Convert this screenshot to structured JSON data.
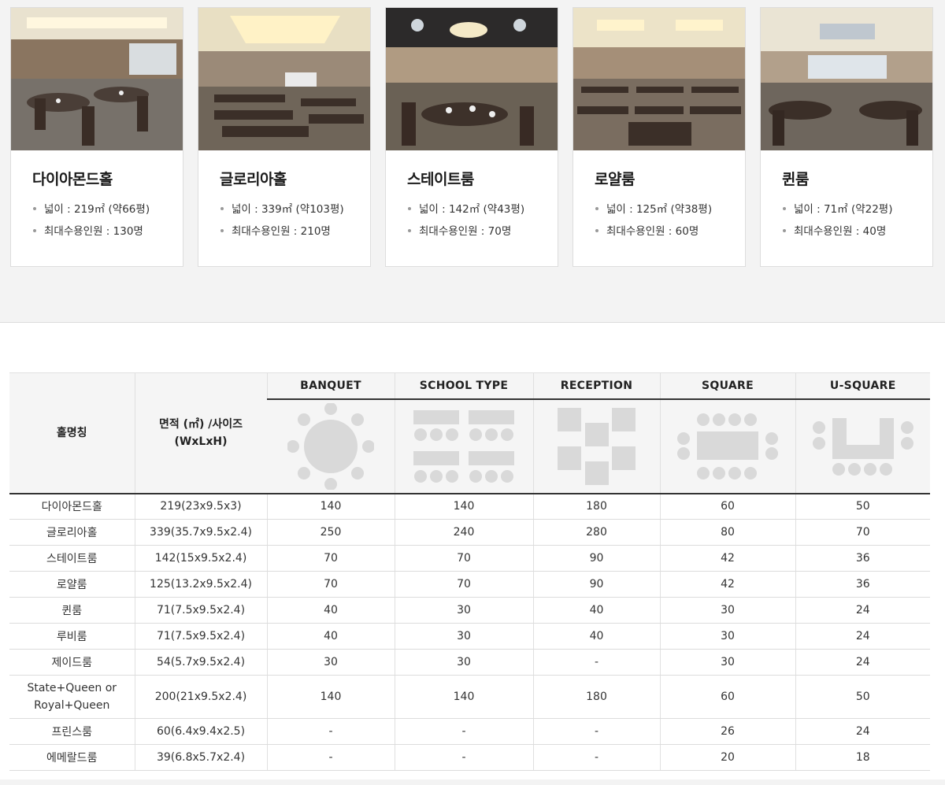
{
  "halls": [
    {
      "name": "다이아몬드홀",
      "area": "넓이 : 219㎡ (약66평)",
      "capacity": "최대수용인원 : 130명"
    },
    {
      "name": "글로리아홀",
      "area": "넓이 : 339㎡ (약103평)",
      "capacity": "최대수용인원 : 210명"
    },
    {
      "name": "스테이트룸",
      "area": "넓이 : 142㎡ (약43평)",
      "capacity": "최대수용인원 : 70명"
    },
    {
      "name": "로얄룸",
      "area": "넓이 : 125㎡ (약38평)",
      "capacity": "최대수용인원 : 60명"
    },
    {
      "name": "퀸룸",
      "area": "넓이 : 71㎡ (약22평)",
      "capacity": "최대수용인원 : 40명"
    }
  ],
  "table": {
    "hall_header": "홀명칭",
    "size_header_line1": "면적 (㎡) /사이즈",
    "size_header_line2": "(WxLxH)",
    "layouts": [
      "BANQUET",
      "SCHOOL TYPE",
      "RECEPTION",
      "SQUARE",
      "U-SQUARE"
    ],
    "rows": [
      [
        "다이아몬드홀",
        "219(23x9.5x3)",
        "140",
        "140",
        "180",
        "60",
        "50"
      ],
      [
        "글로리아홀",
        "339(35.7x9.5x2.4)",
        "250",
        "240",
        "280",
        "80",
        "70"
      ],
      [
        "스테이트룸",
        "142(15x9.5x2.4)",
        "70",
        "70",
        "90",
        "42",
        "36"
      ],
      [
        "로얄룸",
        "125(13.2x9.5x2.4)",
        "70",
        "70",
        "90",
        "42",
        "36"
      ],
      [
        "퀸룸",
        "71(7.5x9.5x2.4)",
        "40",
        "30",
        "40",
        "30",
        "24"
      ],
      [
        "루비룸",
        "71(7.5x9.5x2.4)",
        "40",
        "30",
        "40",
        "30",
        "24"
      ],
      [
        "제이드룸",
        "54(5.7x9.5x2.4)",
        "30",
        "30",
        "-",
        "30",
        "24"
      ],
      [
        "State+Queen or Royal+Queen",
        "200(21x9.5x2.4)",
        "140",
        "140",
        "180",
        "60",
        "50"
      ],
      [
        "프린스룸",
        "60(6.4x9.4x2.5)",
        "-",
        "-",
        "-",
        "26",
        "24"
      ],
      [
        "에메랄드룸",
        "39(6.8x5.7x2.4)",
        "-",
        "-",
        "-",
        "20",
        "18"
      ]
    ]
  },
  "colors": {
    "band_bg": "#f3f3f3",
    "diagram_fill": "#d9d9d9",
    "header_bg": "#f5f5f5",
    "rule": "#333333"
  }
}
